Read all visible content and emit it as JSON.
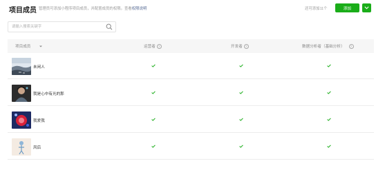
{
  "header": {
    "title": "项目成员",
    "subtitle": "管理员可添加小程序项目成员，并配置成员的权限。查看",
    "subtitle_link": "权限说明",
    "count_text": "还可添加11个",
    "add_button": "添加",
    "more_icon": "chevron-down-icon"
  },
  "search": {
    "placeholder": "请输入搜索关键字",
    "icon": "search-icon"
  },
  "table": {
    "columns": [
      {
        "label": "项目成员",
        "sortable": true
      },
      {
        "label": "运营者",
        "help": "?"
      },
      {
        "label": "开发者",
        "help": "?"
      },
      {
        "label": "数据分析者（基础分析）",
        "help": "?"
      }
    ],
    "rows": [
      {
        "name": "未闲人",
        "operator": true,
        "developer": true,
        "analyst": true
      },
      {
        "name": "我是心中有光的那",
        "operator": true,
        "developer": true,
        "analyst": true
      },
      {
        "name": "我爱我",
        "operator": true,
        "developer": true,
        "analyst": true
      },
      {
        "name": "风后",
        "operator": true,
        "developer": true,
        "analyst": true
      }
    ]
  },
  "colors": {
    "accent": "#1aad19",
    "link": "#576b95",
    "header_bg": "#f6f6f6"
  }
}
